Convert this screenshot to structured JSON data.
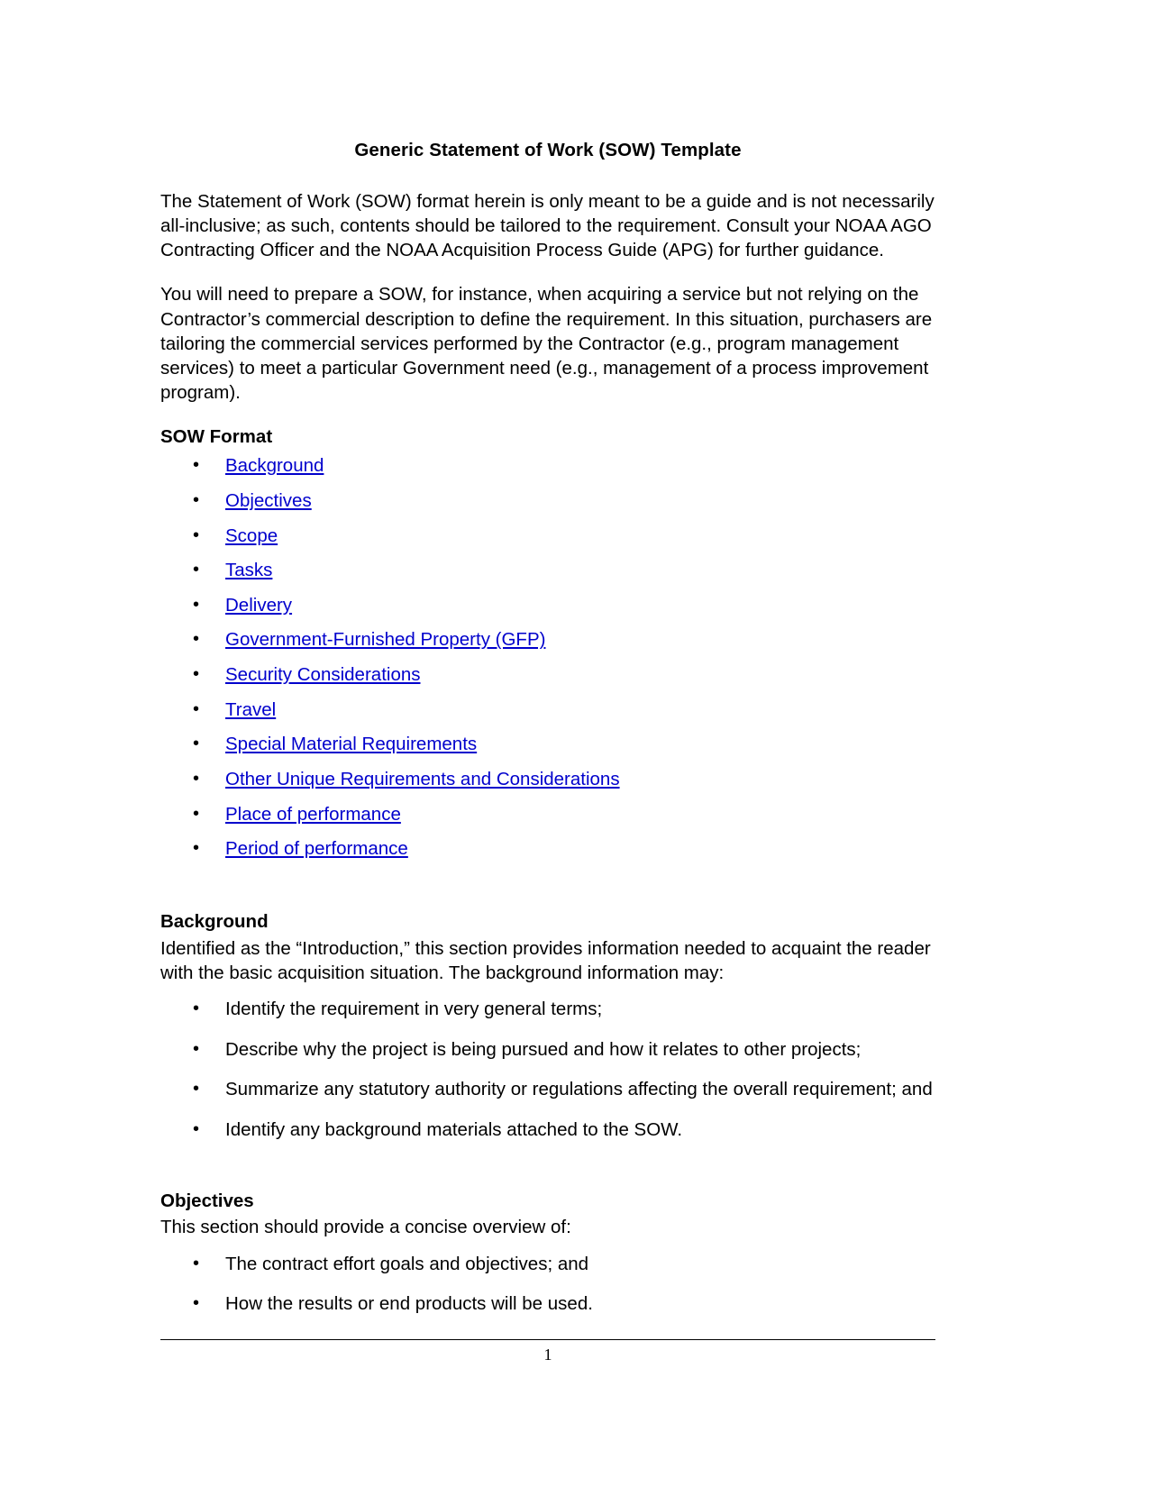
{
  "document": {
    "title": "Generic Statement of Work (SOW) Template",
    "paragraphs": [
      "The Statement of Work (SOW) format herein is only meant to be a guide and is not necessarily all-inclusive; as such, contents should be tailored to the requirement. Consult your NOAA AGO Contracting Officer and the NOAA Acquisition Process Guide (APG) for further guidance.",
      "You will need to prepare a SOW, for instance, when acquiring a service but not relying on the Contractor’s commercial description to define the requirement. In this situation, purchasers are tailoring the commercial services performed by the Contractor (e.g., program management services) to meet a particular Government need (e.g., management of a process improvement program)."
    ],
    "sow_format": {
      "heading": "SOW Format",
      "links": [
        "Background",
        "Objectives",
        "Scope",
        "Tasks",
        "Delivery",
        "Government-Furnished Property (GFP)",
        "Security Considerations",
        "Travel",
        "Special Material Requirements",
        "Other Unique Requirements and Considerations",
        "Place of performance",
        "Period of performance"
      ],
      "link_color": "#0000cc"
    },
    "sections": [
      {
        "heading": "Background",
        "body": "Identified as the “Introduction,” this section provides information needed to acquaint the reader with the basic acquisition situation. The background information may:",
        "bullets": [
          "Identify the requirement in very general terms;",
          "Describe why the project is being pursued and how it relates to other projects;",
          "Summarize any statutory authority or regulations affecting the overall requirement; and",
          "Identify any background materials attached to the SOW."
        ]
      },
      {
        "heading": "Objectives",
        "body": "This section should provide a concise overview of:",
        "bullets": [
          "The contract effort goals and objectives; and",
          "How the results or end products will be used."
        ]
      }
    ],
    "footer": {
      "page_number": "1"
    }
  }
}
